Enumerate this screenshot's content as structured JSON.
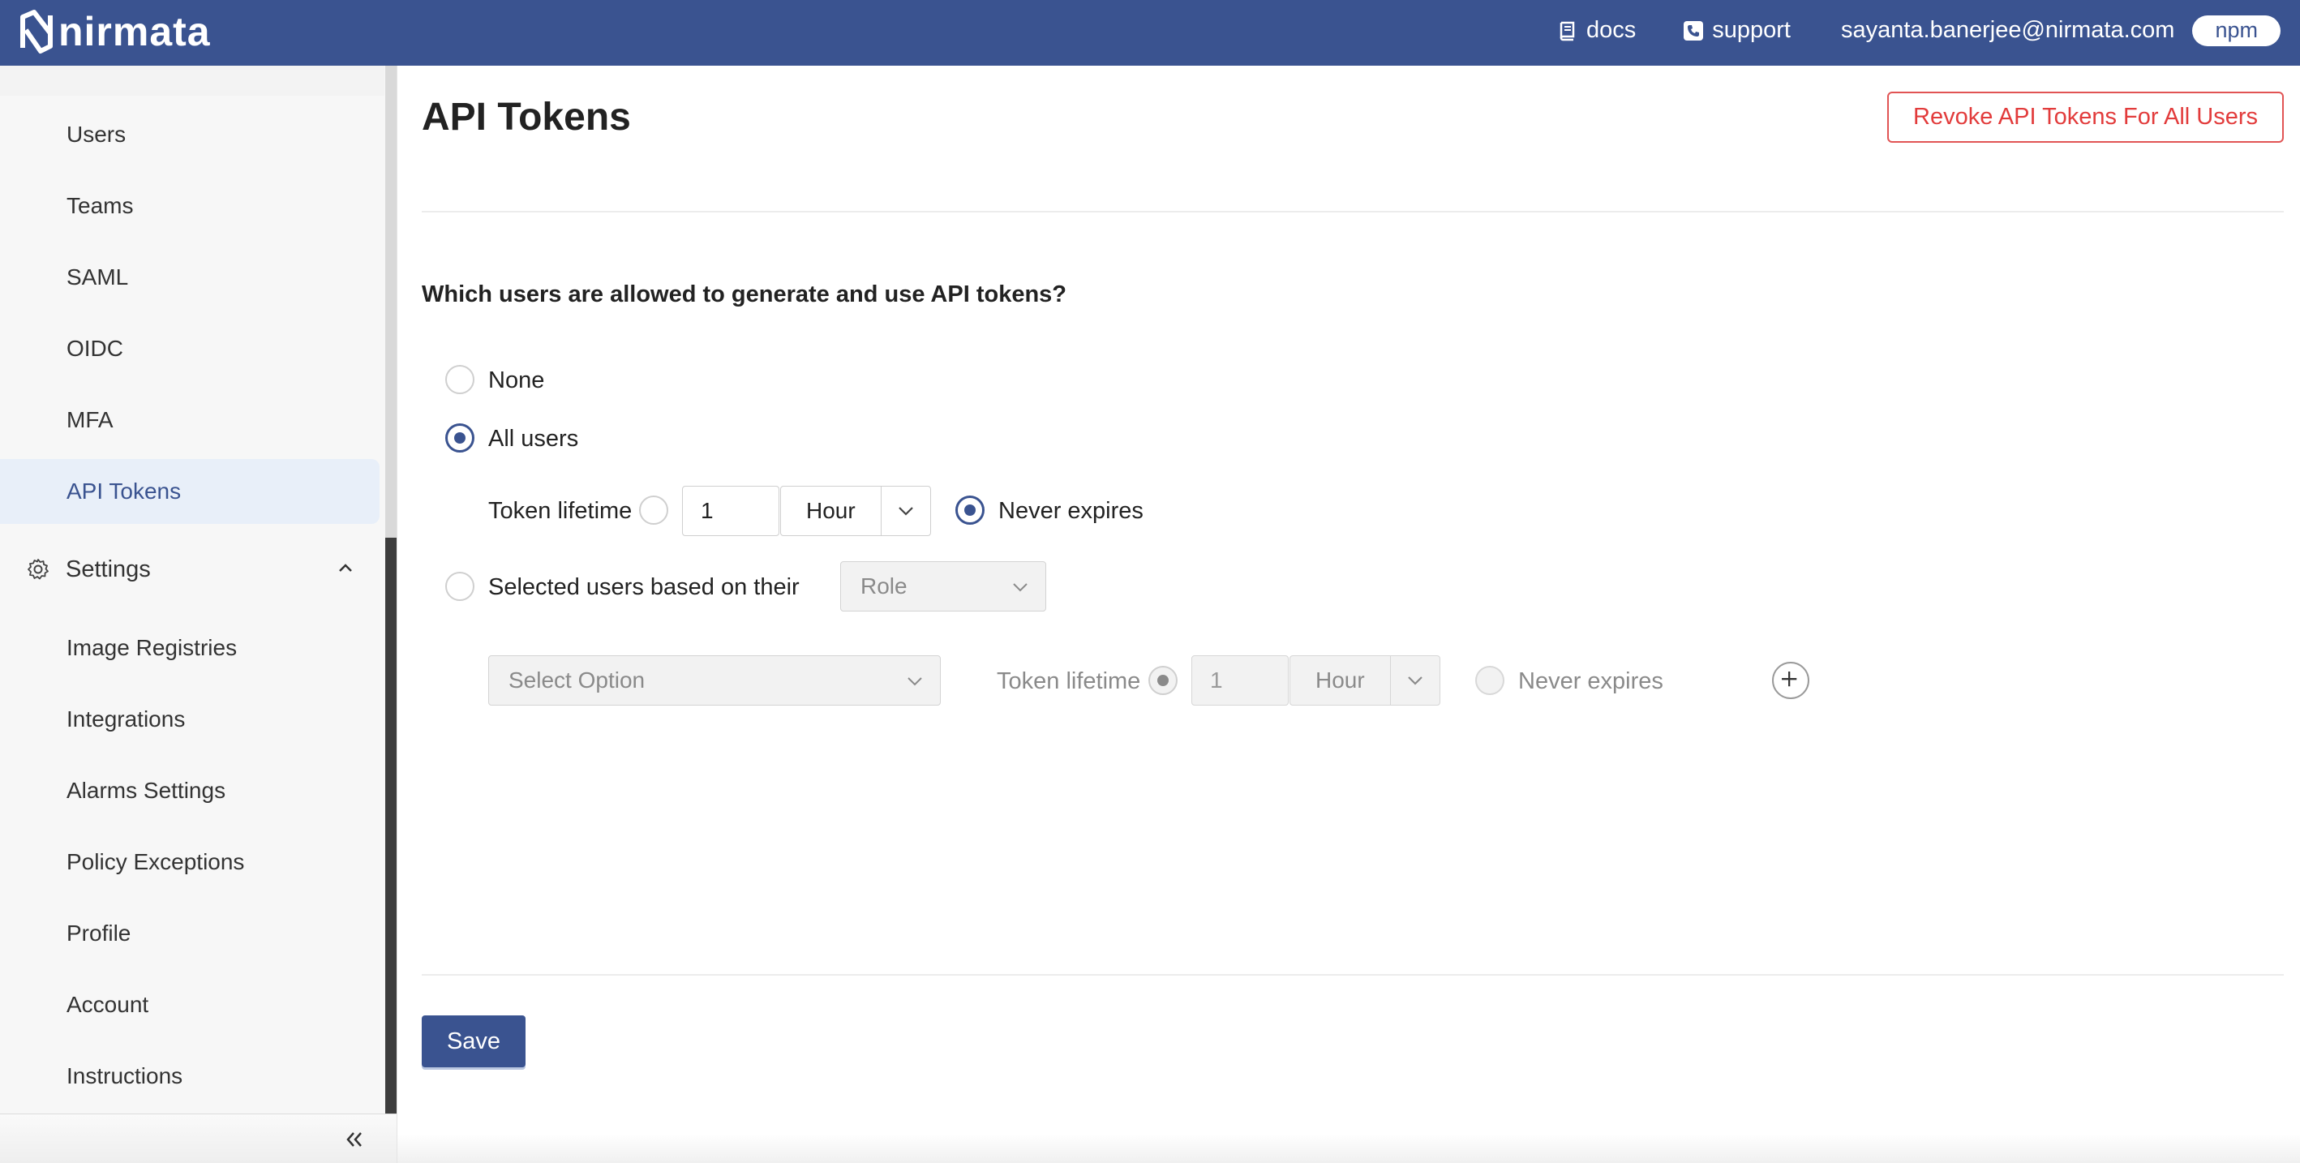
{
  "brand": {
    "name": "nirmata",
    "accent": "#3a5390",
    "danger": "#e23b3b"
  },
  "header": {
    "docs_label": "docs",
    "support_label": "support",
    "user_email": "sayanta.banerjee@nirmata.com",
    "org_label": "npm",
    "docs_icon": "book-icon",
    "support_icon": "phone-icon"
  },
  "sidebar": {
    "items": [
      {
        "label": "Users"
      },
      {
        "label": "Teams"
      },
      {
        "label": "SAML"
      },
      {
        "label": "OIDC"
      },
      {
        "label": "MFA"
      },
      {
        "label": "API Tokens",
        "active": true
      }
    ],
    "settings_group": {
      "label": "Settings",
      "icon": "gear-icon",
      "expanded": true,
      "items": [
        {
          "label": "Image Registries"
        },
        {
          "label": "Integrations"
        },
        {
          "label": "Alarms Settings"
        },
        {
          "label": "Policy Exceptions"
        },
        {
          "label": "Profile"
        },
        {
          "label": "Account"
        },
        {
          "label": "Instructions"
        }
      ]
    },
    "collapse_icon": "double-chevron-left-icon"
  },
  "main": {
    "title": "API Tokens",
    "revoke_button": "Revoke API Tokens For All Users",
    "question": "Which users are allowed to generate and use API tokens?",
    "options": {
      "none": "None",
      "all_users": "All users",
      "selected_users": "Selected users based on their"
    },
    "selected_option": "all_users",
    "all_users_lifetime": {
      "label": "Token lifetime",
      "value": "1",
      "unit": "Hour",
      "never_expires_label": "Never expires",
      "never_expires_selected": true
    },
    "role_select": {
      "value": "Role"
    },
    "selected_users_row": {
      "select_placeholder": "Select Option",
      "lifetime_label": "Token lifetime",
      "value": "1",
      "unit": "Hour",
      "never_expires_label": "Never expires"
    },
    "save_button": "Save"
  }
}
